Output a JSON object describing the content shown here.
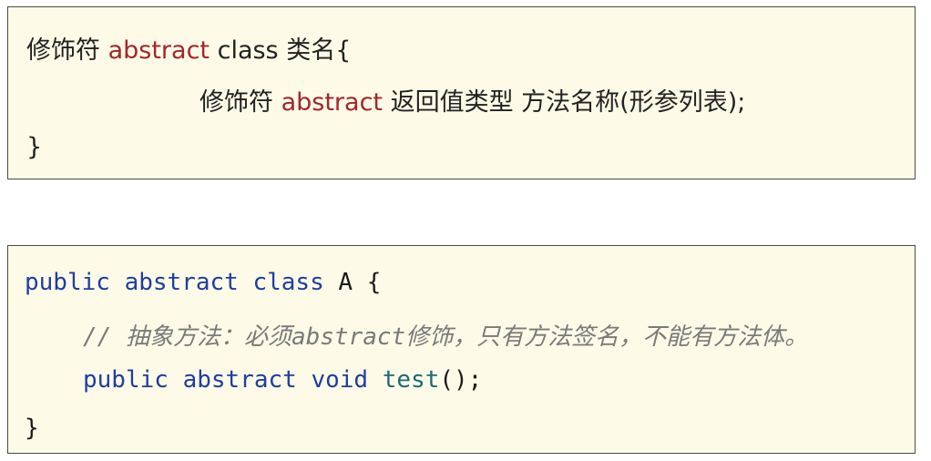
{
  "syntax_box": {
    "line1": {
      "modifier": "修饰符 ",
      "keyword": "abstract",
      "rest": " class 类名{"
    },
    "line2": {
      "modifier": "修饰符 ",
      "keyword": "abstract",
      "rest": " 返回值类型 方法名称(形参列表);"
    },
    "line3": "}"
  },
  "code_box": {
    "line1": {
      "kw1": "public",
      "kw2": "abstract",
      "kw3": "class",
      "rest": " A {"
    },
    "comment": "// 抽象方法：必须abstract修饰，只有方法签名，不能有方法体。",
    "line3": {
      "kw1": "public",
      "kw2": "abstract",
      "kw3": "void",
      "fn": "test",
      "rest": "();"
    },
    "line4": "}"
  },
  "colors": {
    "background": "#fdfbe7",
    "border": "#4a4a4a",
    "keyword_red": "#a3262a",
    "keyword_blue": "#1f3ea0",
    "function_teal": "#1d6a76",
    "comment_gray": "#7a7a7a"
  }
}
